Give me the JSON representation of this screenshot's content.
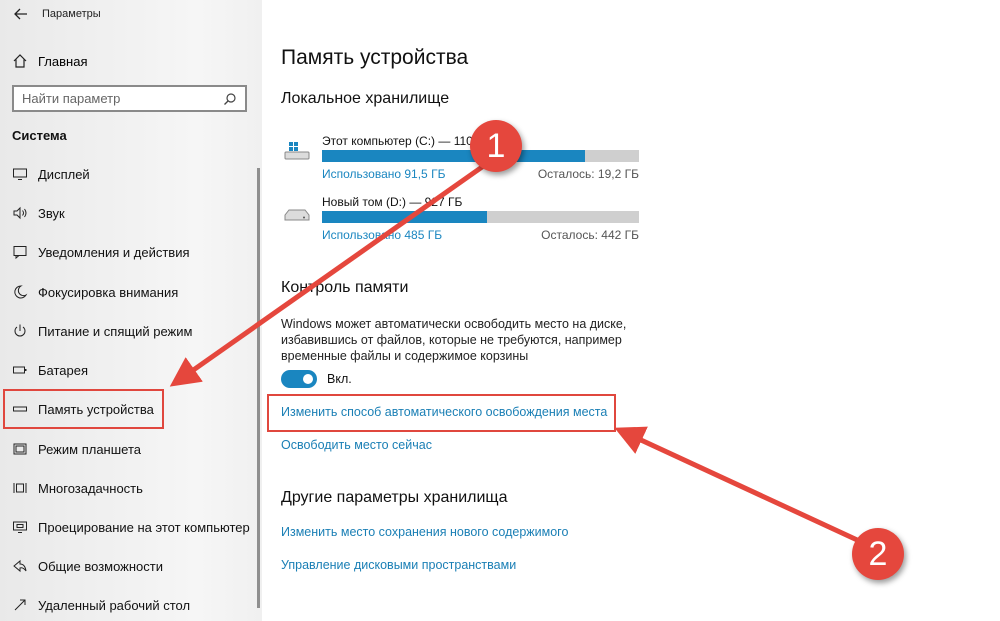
{
  "window": {
    "title": "Параметры"
  },
  "sidebar": {
    "home_label": "Главная",
    "search_placeholder": "Найти параметр",
    "section_title": "Система",
    "items": [
      {
        "label": "Дисплей",
        "icon": "monitor-icon"
      },
      {
        "label": "Звук",
        "icon": "speaker-icon"
      },
      {
        "label": "Уведомления и действия",
        "icon": "notification-icon"
      },
      {
        "label": "Фокусировка внимания",
        "icon": "moon-icon"
      },
      {
        "label": "Питание и спящий режим",
        "icon": "power-icon"
      },
      {
        "label": "Батарея",
        "icon": "battery-icon"
      },
      {
        "label": "Память устройства",
        "icon": "storage-icon",
        "selected": true
      },
      {
        "label": "Режим планшета",
        "icon": "tablet-icon"
      },
      {
        "label": "Многозадачность",
        "icon": "multitask-icon"
      },
      {
        "label": "Проецирование на этот компьютер",
        "icon": "project-icon"
      },
      {
        "label": "Общие возможности",
        "icon": "share-icon"
      },
      {
        "label": "Удаленный рабочий стол",
        "icon": "remote-icon"
      }
    ]
  },
  "main": {
    "title": "Память устройства",
    "local_storage_heading": "Локальное хранилище",
    "drives": [
      {
        "name": "Этот компьютер (C:) — 110",
        "used": "Использовано 91,5 ГБ",
        "free": "Осталось: 19,2 ГБ",
        "used_fraction": 0.83,
        "icon": "windows-drive-icon"
      },
      {
        "name": "Новый том (D:) — 927 ГБ",
        "used": "Использовано 485 ГБ",
        "free": "Осталось: 442 ГБ",
        "used_fraction": 0.52,
        "icon": "drive-icon"
      }
    ],
    "storage_sense_heading": "Контроль памяти",
    "storage_sense_desc": "Windows может автоматически освободить место на диске, избавившись от файлов, которые не требуются, например временные файлы и содержимое корзины",
    "toggle_label": "Вкл.",
    "toggle_on": true,
    "link_change_auto": "Изменить способ автоматического освобождения места",
    "link_free_now": "Освободить место сейчас",
    "other_heading": "Другие параметры хранилища",
    "link_change_save_location": "Изменить место сохранения нового содержимого",
    "link_manage_spaces": "Управление дисковыми пространствами"
  },
  "annotations": {
    "badge1": "1",
    "badge2": "2",
    "accent": "#e5473d"
  },
  "colors": {
    "accent": "#1a86c0",
    "link": "#1a7fb5",
    "bar_bg": "#cfcfcf"
  }
}
